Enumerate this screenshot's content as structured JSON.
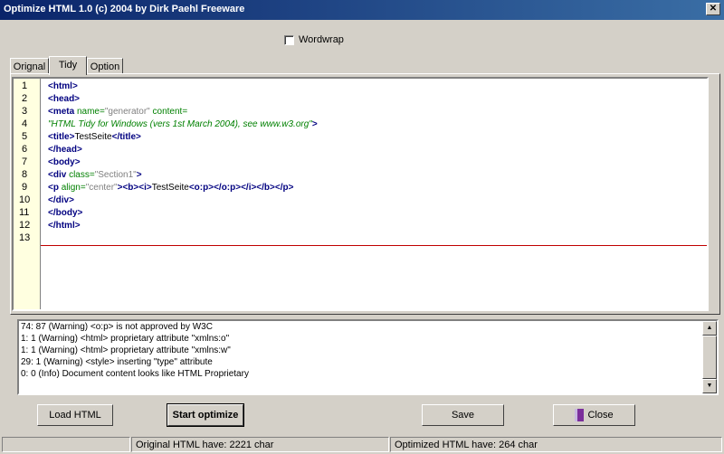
{
  "window": {
    "title": "Optimize HTML 1.0 (c) 2004 by Dirk Paehl Freeware"
  },
  "wordwrap": {
    "label": "Wordwrap",
    "checked": false
  },
  "tabs": [
    {
      "label": "Orignal",
      "active": false
    },
    {
      "label": "Tidy",
      "active": true
    },
    {
      "label": "Option",
      "active": false
    }
  ],
  "editor": {
    "line_numbers": [
      "1",
      "2",
      "3",
      "4",
      "5",
      "6",
      "7",
      "8",
      "9",
      "10",
      "11",
      "12",
      "13"
    ]
  },
  "log": [
    "74: 87     (Warning) <o:p> is not approved by W3C",
    "1: 1     (Warning) <html> proprietary attribute \"xmlns:o\"",
    "1: 1     (Warning) <html> proprietary attribute \"xmlns:w\"",
    "29: 1     (Warning) <style> inserting \"type\" attribute",
    "0: 0     (Info) Document content looks like HTML Proprietary"
  ],
  "buttons": {
    "load": "Load HTML",
    "start": "Start optimize",
    "save": "Save",
    "close": "Close"
  },
  "status": {
    "original": "Original HTML have: 2221 char",
    "optimized": "Optimized HTML have: 264 char"
  },
  "icons": {
    "close_button": "book-icon"
  }
}
